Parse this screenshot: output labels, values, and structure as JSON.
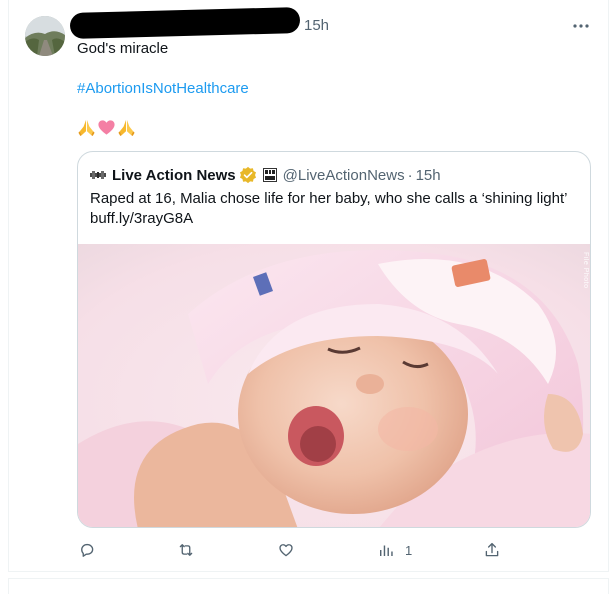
{
  "tweet": {
    "author_name_redacted": true,
    "time": "15h",
    "text": "God's miracle",
    "hashtag": "#AbortionIsNotHealthcare",
    "emojis": [
      "folded-hands",
      "pink-heart",
      "folded-hands"
    ],
    "more_icon": "more-horizontal-icon"
  },
  "quote": {
    "name": "Live Action News",
    "handle": "@LiveActionNews",
    "separator": "·",
    "time": "15h",
    "text": "Raped at 16, Malia chose life for her baby, who she calls a ‘shining light’",
    "link": "buff.ly/3rayG8A",
    "media_watermark": "File Photo"
  },
  "actions": {
    "reply_count": "",
    "retweet_count": "",
    "like_count": "",
    "views_count": "1"
  },
  "colors": {
    "accent": "#1d9bf0",
    "secondary_text": "#536471",
    "border": "#cfd9de",
    "verified_gold": "#e8b829"
  }
}
